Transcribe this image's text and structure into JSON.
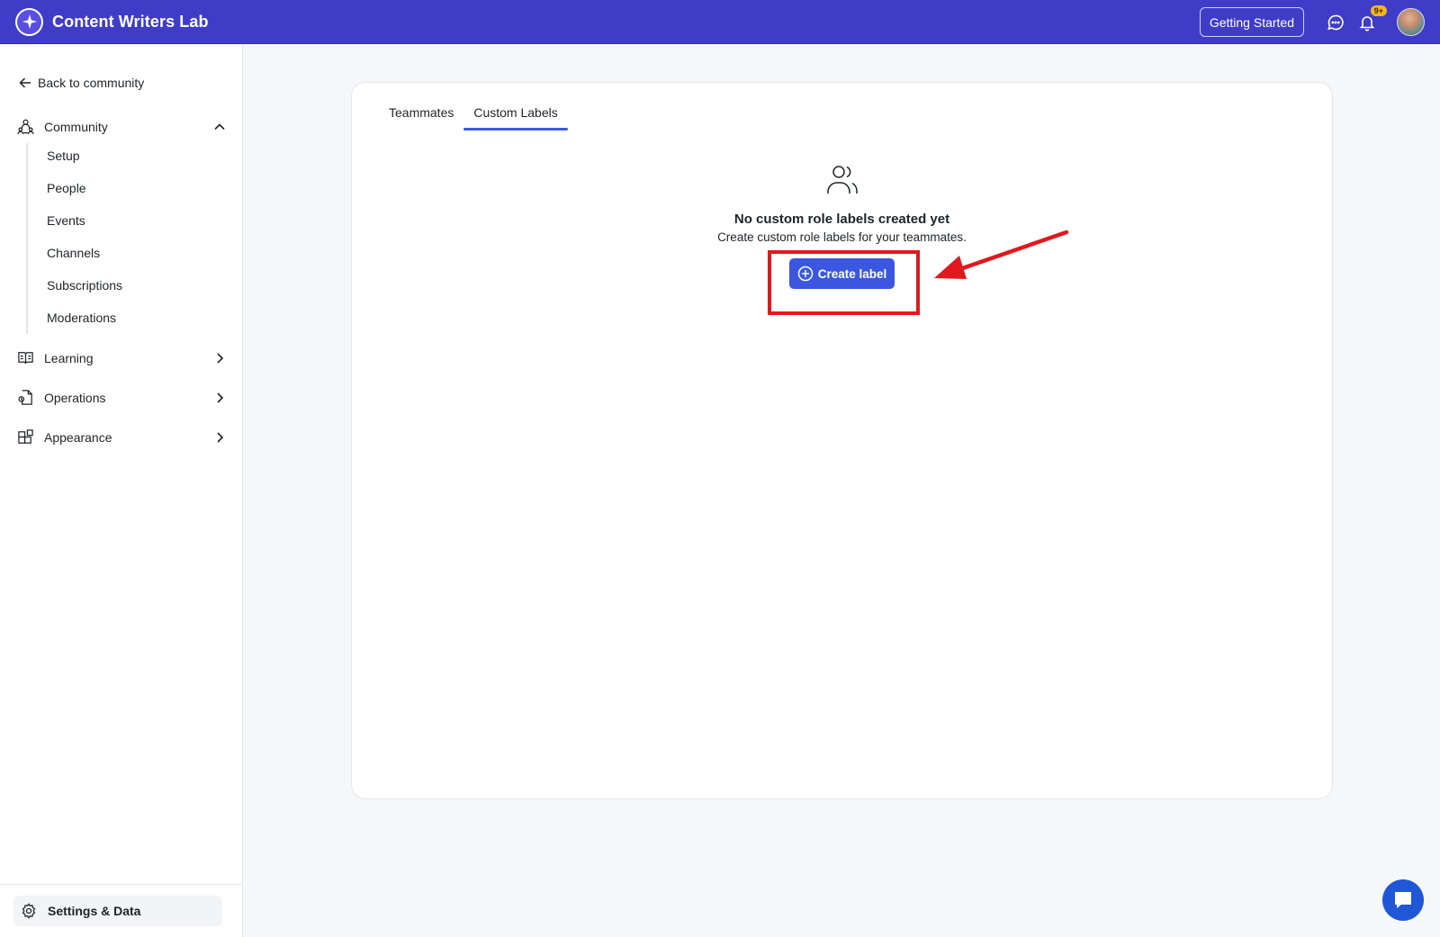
{
  "topbar": {
    "brand_name": "Content Writers Lab",
    "getting_started_label": "Getting Started",
    "notification_badge": "9+",
    "brand_color": "#3f3cc8"
  },
  "sidebar": {
    "back_label": "Back to community",
    "sections": {
      "community": "Community",
      "learning": "Learning",
      "operations": "Operations",
      "appearance": "Appearance"
    },
    "community_items": [
      "Setup",
      "People",
      "Events",
      "Channels",
      "Subscriptions",
      "Moderations"
    ],
    "settings_label": "Settings & Data"
  },
  "main": {
    "tabs": [
      "Teammates",
      "Custom Labels"
    ],
    "active_tab": "Custom Labels",
    "empty_title": "No custom role labels created yet",
    "empty_subtitle": "Create custom role labels for your teammates.",
    "create_button_label": "Create label",
    "accent_color": "#3b57e0"
  },
  "annotation": {
    "highlight_color": "#e0191d"
  }
}
